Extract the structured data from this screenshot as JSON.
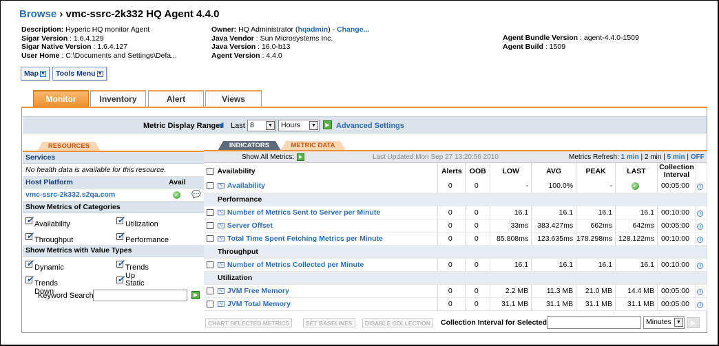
{
  "header": {
    "crumb": "Browse",
    "separator": " › ",
    "title": "vmc-ssrc-2k332 HQ Agent 4.4.0"
  },
  "info_left": [
    {
      "label": "Description:",
      "value": " Hyperic HQ monitor Agent"
    },
    {
      "label": "Sigar Version",
      "value": " : 1.6.4.129"
    },
    {
      "label": "Sigar Native Version",
      "value": " : 1.6.4.127"
    },
    {
      "label": "User Home",
      "value": " : C:\\Documents and Settings\\Defa..."
    }
  ],
  "info_mid": {
    "owner_label": "Owner:",
    "owner_value": " HQ Administrator (",
    "owner_link": "hqadmin",
    "owner_close": ") - ",
    "change_link": "Change...",
    "rows": [
      {
        "label": "Java Vendor",
        "value": " : Sun Microsystems Inc."
      },
      {
        "label": "Java Version",
        "value": " : 16.0-b13"
      },
      {
        "label": "Agent Version",
        "value": " : 4.4.0"
      }
    ]
  },
  "info_right": [
    {
      "label": "Agent Bundle Version",
      "value": " : agent-4.4.0-1509"
    },
    {
      "label": "Agent Build",
      "value": " : 1509"
    }
  ],
  "buttons": {
    "map": "Map",
    "tools": "Tools Menu"
  },
  "tabs": [
    "Monitor",
    "Inventory",
    "Alert",
    "Views"
  ],
  "range": {
    "label": "Metric Display Range:",
    "last": "Last",
    "count": "8",
    "unit": "Hours",
    "advanced": "Advanced Settings"
  },
  "left": {
    "resources_tab": "RESOURCES",
    "services_head": "Services",
    "no_health": "No health data is available for this resource.",
    "host_head": "Host Platform",
    "avail_head": "Avail",
    "host_name": "vmc-ssrc-2k332.s2qa.com",
    "categories_head": "Show Metrics of Categories",
    "categories": [
      "Availability",
      "Utilization",
      "Throughput",
      "Performance"
    ],
    "types_head": "Show Metrics with Value Types",
    "types": [
      "Dynamic",
      "Trends Up",
      "Trends Down",
      "Static"
    ],
    "keyword_label": "Keyword Search:"
  },
  "right": {
    "indicators_tab": "INDICATORS",
    "metric_tab": "METRIC DATA",
    "show_all": "Show All Metrics:",
    "last_updated": "Last Updated:Mon Sep 27 13:20:56 2010",
    "refresh_label": "Metrics Refresh:",
    "refresh_1": "1 min",
    "refresh_2": "2 min",
    "refresh_5": "5 min",
    "refresh_off": "OFF",
    "refresh_sep": "|",
    "columns": [
      "Availability",
      "Alerts",
      "OOB",
      "LOW",
      "AVG",
      "PEAK",
      "LAST",
      "Collection Interval"
    ]
  },
  "groups": [
    {
      "rows": [
        {
          "name": "Availability",
          "alerts": "0",
          "oob": "0",
          "low": "-",
          "avg": "100.0%",
          "peak": "-",
          "last": "",
          "interval": "00:05:00"
        }
      ]
    },
    {
      "title": "Performance",
      "rows": [
        {
          "name": "Number of Metrics Sent to Server per Minute",
          "alerts": "0",
          "oob": "0",
          "low": "16.1",
          "avg": "16.1",
          "peak": "16.1",
          "last": "16.1",
          "interval": "00:10:00"
        },
        {
          "name": "Server Offset",
          "alerts": "0",
          "oob": "0",
          "low": "33ms",
          "avg": "383.427ms",
          "peak": "662ms",
          "last": "642ms",
          "interval": "00:05:00"
        },
        {
          "name": "Total Time Spent Fetching Metrics per Minute",
          "alerts": "0",
          "oob": "0",
          "low": "85.808ms",
          "avg": "123.635ms",
          "peak": "178.298ms",
          "last": "128.122ms",
          "interval": "00:10:00"
        }
      ]
    },
    {
      "title": "Throughput",
      "rows": [
        {
          "name": "Number of Metrics Collected per Minute",
          "alerts": "0",
          "oob": "0",
          "low": "16.1",
          "avg": "16.1",
          "peak": "16.1",
          "last": "16.1",
          "interval": "00:10:00"
        }
      ]
    },
    {
      "title": "Utilization",
      "rows": [
        {
          "name": "JVM Free Memory",
          "alerts": "0",
          "oob": "0",
          "low": "2.2 MB",
          "avg": "11.3 MB",
          "peak": "21.0 MB",
          "last": "14.4 MB",
          "interval": "00:05:00"
        },
        {
          "name": "JVM Total Memory",
          "alerts": "0",
          "oob": "0",
          "low": "31.1 MB",
          "avg": "31.1 MB",
          "peak": "31.1 MB",
          "last": "31.1 MB",
          "interval": "00:05:00"
        }
      ]
    }
  ],
  "bottom": {
    "chart_btn": "CHART SELECTED METRICS",
    "baseline_btn": "SET BASELINES",
    "disable_btn": "DISABLE COLLECTION",
    "interval_label": "Collection Interval for Selected:",
    "interval_unit": "Minutes"
  },
  "colors": {
    "accent": "#ef8f2f",
    "link": "#2c6db3",
    "group_bg": "#e7ecf3"
  }
}
